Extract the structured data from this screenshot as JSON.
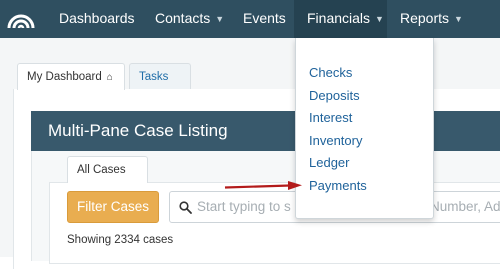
{
  "navbar": {
    "logo_icon": "rainbow-arc-icon",
    "items": [
      {
        "label": "Dashboards",
        "caret": false,
        "active": false
      },
      {
        "label": "Contacts",
        "caret": true,
        "active": false
      },
      {
        "label": "Events",
        "caret": false,
        "active": false
      },
      {
        "label": "Financials",
        "caret": true,
        "active": true
      },
      {
        "label": "Reports",
        "caret": true,
        "active": false
      }
    ],
    "colors": {
      "background": "#2f4f60",
      "active": "#254251"
    }
  },
  "tabs": [
    {
      "label": "My Dashboard",
      "icon": "home-icon",
      "active": true
    },
    {
      "label": "Tasks",
      "icon": "close-icon",
      "active": false
    }
  ],
  "panel": {
    "title": "Multi-Pane Case Listing",
    "subtab": "All Cases",
    "filter_button": "Filter Cases",
    "search_placeholder": "Start typing to s",
    "search_placeholder_tail": "Number, Ad",
    "case_count": "Showing 2334 cases"
  },
  "financials_menu": {
    "items": [
      "Checks",
      "Deposits",
      "Interest",
      "Inventory",
      "Ledger",
      "Payments"
    ],
    "highlighted": "Payments"
  },
  "annotation": {
    "type": "red-arrow",
    "points_to": "Payments",
    "color": "#b31b1b"
  },
  "colors": {
    "accent": "#e9ad50",
    "link": "#20639b",
    "header": "#38596c"
  }
}
